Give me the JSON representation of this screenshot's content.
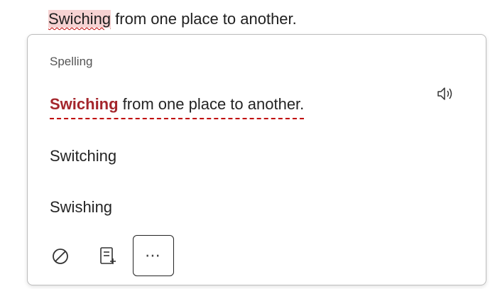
{
  "document": {
    "misspelled_word": "Swiching",
    "rest_of_sentence": " from one place to another."
  },
  "card": {
    "section_label": "Spelling",
    "context": {
      "word": "Swiching",
      "rest": " from one place to another."
    },
    "suggestions": [
      {
        "label": "Switching"
      },
      {
        "label": "Swishing"
      }
    ],
    "toolbar": {
      "ignore_icon": "ignore-icon",
      "add_to_dictionary_icon": "add-to-dictionary-icon",
      "more_label": "⋯"
    },
    "read_aloud_icon": "speaker-icon"
  },
  "colors": {
    "error_red": "#c00000",
    "error_word": "#a4262c",
    "highlight": "#f6d2d2"
  }
}
